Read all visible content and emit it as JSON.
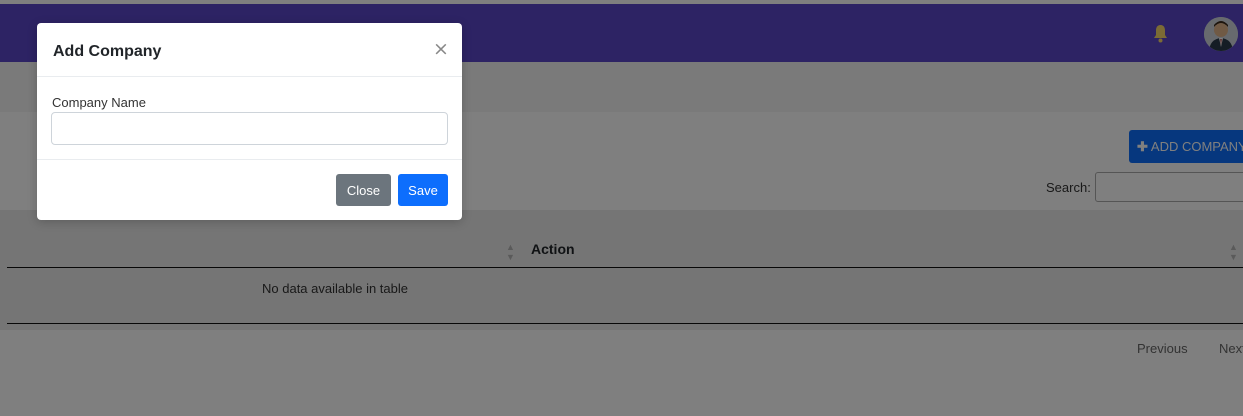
{
  "navbar": {
    "color": "#5a46c8",
    "notification_icon": "bell-icon",
    "avatar_icon": "user-avatar"
  },
  "toolbar": {
    "add_button_icon": "plus-icon",
    "add_button_label": "ADD COMPANY",
    "search_label": "Search:"
  },
  "table": {
    "columns": [
      "Action"
    ],
    "empty_message": "No data available in table",
    "sort_icon": "sort-icon"
  },
  "pagination": {
    "previous": "Previous",
    "next": "Next"
  },
  "modal": {
    "title": "Add Company",
    "close_icon": "×",
    "field_label": "Company Name",
    "field_value": "",
    "field_placeholder": "",
    "close_label": "Close",
    "save_label": "Save"
  },
  "colors": {
    "primary": "#0d6efd",
    "secondary": "#6c757d"
  }
}
